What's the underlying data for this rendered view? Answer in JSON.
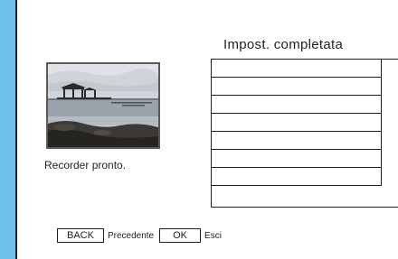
{
  "screen": {
    "title": "Impost. completata",
    "status": "Recorder pronto.",
    "list_row_count": 7
  },
  "footer": {
    "back_key": "BACK",
    "back_label": "Precedente",
    "ok_key": "OK",
    "ok_label": "Esci"
  },
  "colors": {
    "frame": "#6cc2ec",
    "panel": "#ffffff",
    "ink": "#231f20"
  }
}
